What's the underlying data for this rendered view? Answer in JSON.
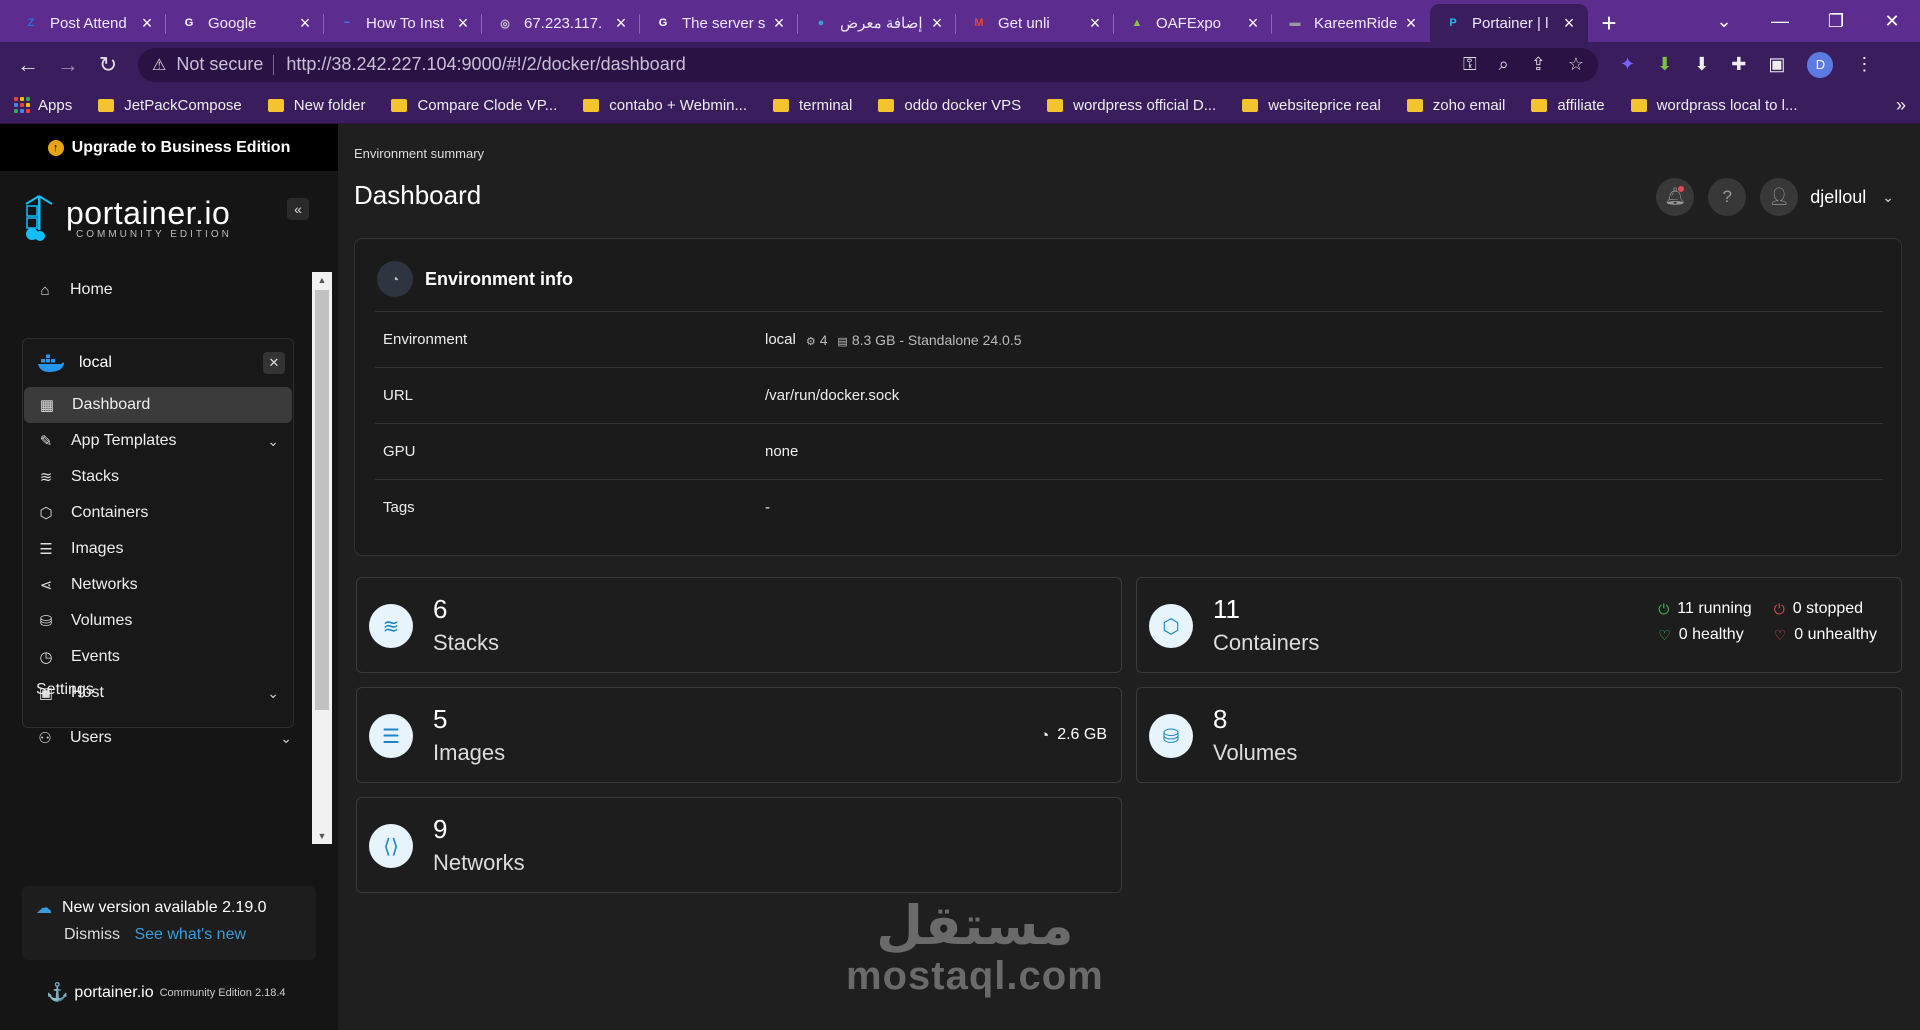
{
  "browser": {
    "tabs": [
      {
        "title": "Post Attend",
        "favicon": "Z",
        "color": "#2d6cdf"
      },
      {
        "title": "Google",
        "favicon": "G",
        "color": "#ffffff"
      },
      {
        "title": "How To Inst",
        "favicon": "~",
        "color": "#3b82f6"
      },
      {
        "title": "67.223.117.",
        "favicon": "◎",
        "color": "#cccccc"
      },
      {
        "title": "The server s",
        "favicon": "G",
        "color": "#ffffff"
      },
      {
        "title": "إضافة معرض",
        "favicon": "●",
        "color": "#3b9cd9"
      },
      {
        "title": "Get unli",
        "favicon": "M",
        "color": "#ea4335"
      },
      {
        "title": "OAFExpo",
        "favicon": "▲",
        "color": "#8bc34a"
      },
      {
        "title": "KareemRide",
        "favicon": "▬",
        "color": "#999999"
      },
      {
        "title": "Portainer | l",
        "favicon": "P",
        "color": "#13bef9"
      }
    ],
    "active_tab_index": 9,
    "new_tab_label": "+",
    "address": {
      "security_label": "Not secure",
      "url_host": "http://38.242.227.104",
      "url_path": ":9000/#!/2/docker/dashboard"
    },
    "profile_initial": "D",
    "bookmarks": [
      {
        "label": "Apps",
        "type": "apps"
      },
      {
        "label": "JetPackCompose",
        "type": "folder"
      },
      {
        "label": "New folder",
        "type": "folder"
      },
      {
        "label": "Compare Clode VP...",
        "type": "folder"
      },
      {
        "label": "contabo + Webmin...",
        "type": "folder"
      },
      {
        "label": "terminal",
        "type": "folder"
      },
      {
        "label": "oddo docker VPS",
        "type": "folder"
      },
      {
        "label": "wordpress official D...",
        "type": "folder"
      },
      {
        "label": "websiteprice real",
        "type": "folder"
      },
      {
        "label": "zoho email",
        "type": "folder"
      },
      {
        "label": "affiliate",
        "type": "folder"
      },
      {
        "label": "wordprass local to l...",
        "type": "folder"
      }
    ],
    "bookmarks_more": "»"
  },
  "sidebar": {
    "upgrade_label": "Upgrade to Business Edition",
    "logo_text": "portainer.io",
    "logo_sub": "COMMUNITY EDITION",
    "collapse_label": "«",
    "home_label": "Home",
    "environment_name": "local",
    "env_items": [
      {
        "label": "Dashboard",
        "icon": "dashboard-icon",
        "active": true,
        "expand": false
      },
      {
        "label": "App Templates",
        "icon": "edit-icon",
        "active": false,
        "expand": true
      },
      {
        "label": "Stacks",
        "icon": "layers-icon",
        "active": false,
        "expand": false
      },
      {
        "label": "Containers",
        "icon": "box-icon",
        "active": false,
        "expand": false
      },
      {
        "label": "Images",
        "icon": "list-icon",
        "active": false,
        "expand": false
      },
      {
        "label": "Networks",
        "icon": "share-icon",
        "active": false,
        "expand": false
      },
      {
        "label": "Volumes",
        "icon": "database-icon",
        "active": false,
        "expand": false
      },
      {
        "label": "Events",
        "icon": "clock-icon",
        "active": false,
        "expand": false
      },
      {
        "label": "Host",
        "icon": "host-icon",
        "active": false,
        "expand": true
      }
    ],
    "settings_label": "Settings",
    "users_label": "Users",
    "new_version": {
      "title": "New version available 2.19.0",
      "dismiss": "Dismiss",
      "link": "See what's new"
    },
    "footer": {
      "brand": "portainer.io",
      "edition": "Community Edition 2.18.4"
    }
  },
  "header": {
    "breadcrumb": "Environment summary",
    "title": "Dashboard",
    "username": "djelloul"
  },
  "environment_info": {
    "title": "Environment info",
    "rows": [
      {
        "key": "Environment",
        "value": "local",
        "meta_cpu": "4",
        "meta_mem": "8.3 GB",
        "meta_rest": "- Standalone 24.0.5"
      },
      {
        "key": "URL",
        "value": "/var/run/docker.sock"
      },
      {
        "key": "GPU",
        "value": "none"
      },
      {
        "key": "Tags",
        "value": "-"
      }
    ]
  },
  "cards": {
    "stacks": {
      "count": "6",
      "label": "Stacks"
    },
    "containers": {
      "count": "11",
      "label": "Containers",
      "running": "11 running",
      "stopped": "0 stopped",
      "healthy": "0 healthy",
      "unhealthy": "0 unhealthy"
    },
    "images": {
      "count": "5",
      "label": "Images",
      "size": "2.6 GB"
    },
    "volumes": {
      "count": "8",
      "label": "Volumes"
    },
    "networks": {
      "count": "9",
      "label": "Networks"
    }
  },
  "watermark": {
    "arabic": "مستقل",
    "latin": "mostaql.com"
  }
}
